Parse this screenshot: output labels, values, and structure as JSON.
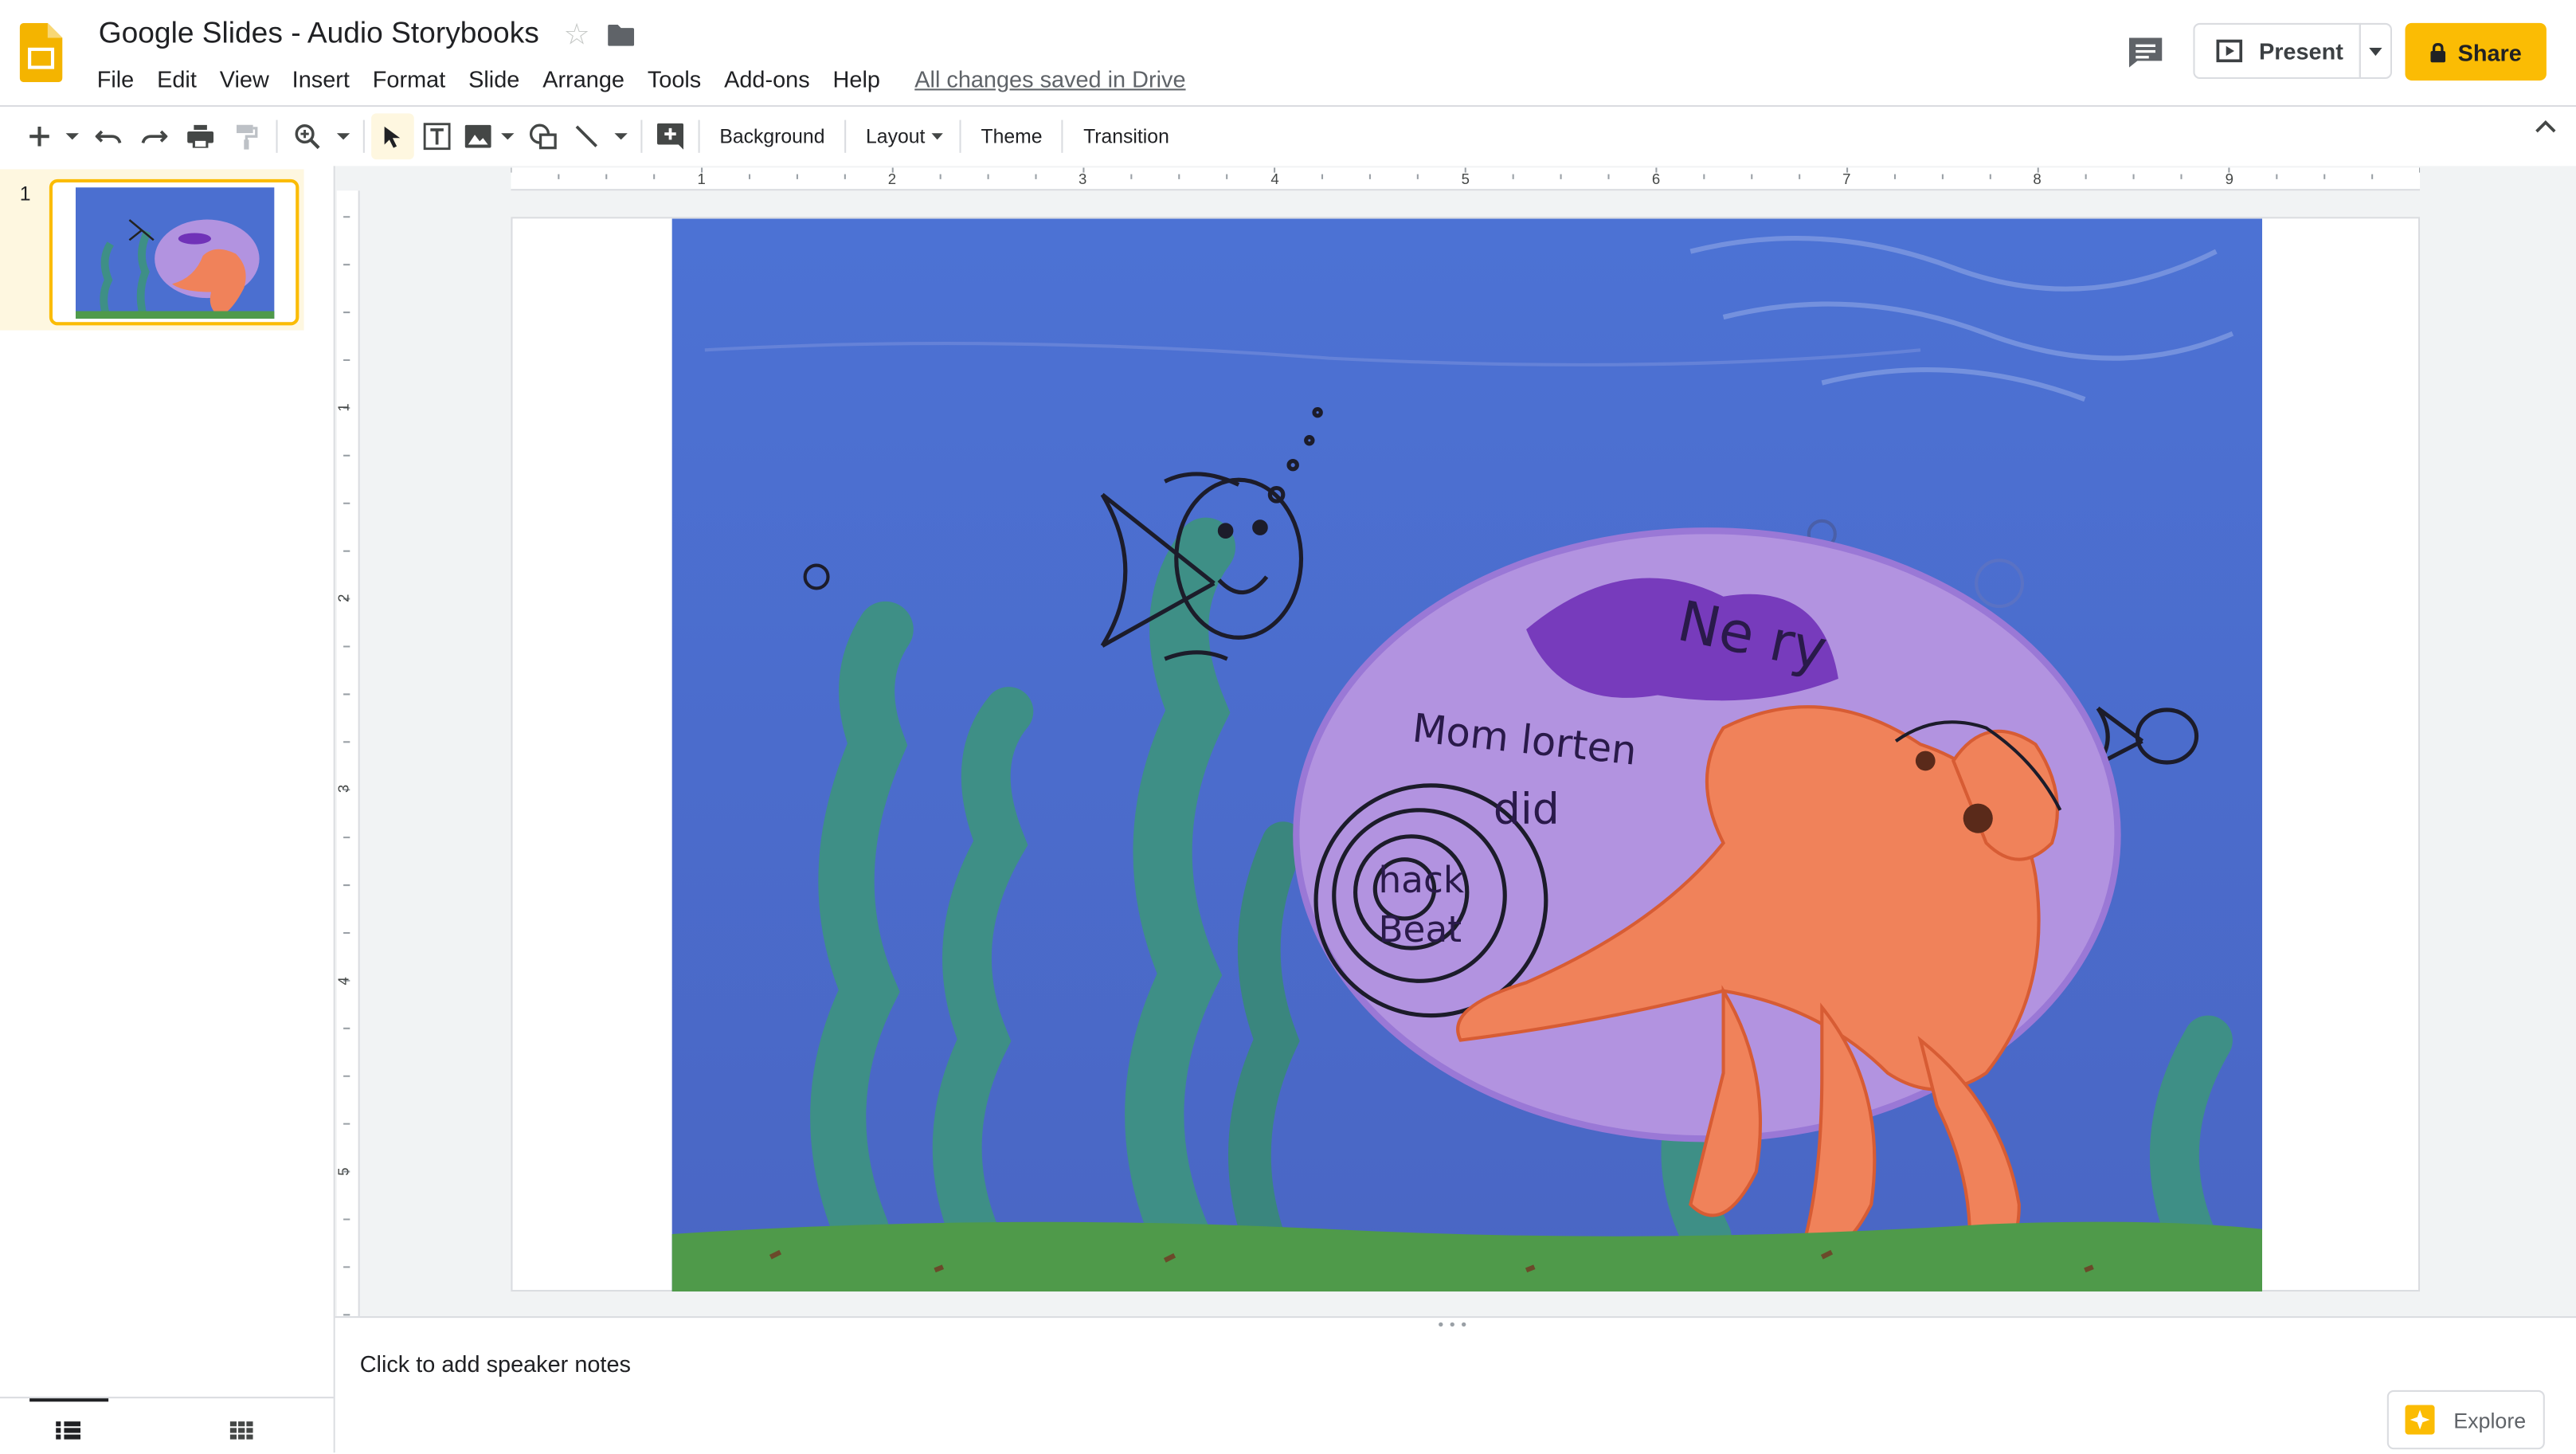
{
  "app": {
    "title": "Google Slides - Audio Storybooks",
    "save_status": "All changes saved in Drive"
  },
  "menu": [
    "File",
    "Edit",
    "View",
    "Insert",
    "Format",
    "Slide",
    "Arrange",
    "Tools",
    "Add-ons",
    "Help"
  ],
  "header": {
    "present_label": "Present",
    "share_label": "Share"
  },
  "toolbar": {
    "background_label": "Background",
    "layout_label": "Layout",
    "theme_label": "Theme",
    "transition_label": "Transition"
  },
  "ruler": {
    "horizontal_ticks": [
      "1",
      "2",
      "3",
      "4",
      "5",
      "6",
      "7",
      "8",
      "9"
    ],
    "vertical_ticks": [
      "1",
      "2",
      "3",
      "4",
      "5"
    ]
  },
  "filmstrip": {
    "slides": [
      {
        "number": "1"
      }
    ]
  },
  "slide": {
    "drawing_text_1": "Ne ry",
    "drawing_text_2": "Mom lorten",
    "drawing_text_3": "did",
    "drawing_text_4": "hack",
    "drawing_text_5": "Beat"
  },
  "notes": {
    "placeholder": "Click to add speaker notes"
  },
  "explore": {
    "label": "Explore"
  },
  "colors": {
    "accent": "#fbbc04",
    "ocean": "#4b6fd0",
    "shell": "#b293e0",
    "crab": "#f0825a",
    "seaweed": "#3e8f86"
  }
}
